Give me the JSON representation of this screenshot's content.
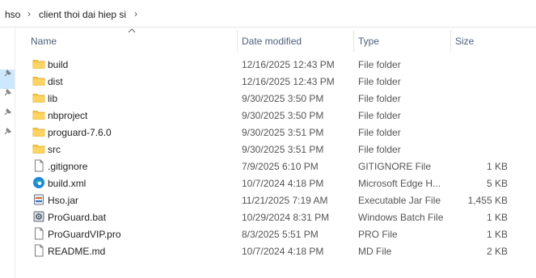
{
  "breadcrumb": {
    "items": [
      "hso",
      "client thoi dai hiep si"
    ],
    "separator": "›"
  },
  "columns": {
    "name": "Name",
    "date": "Date modified",
    "type": "Type",
    "size": "Size"
  },
  "sort_indicator": "chevron-up-icon",
  "files": [
    {
      "name": "build",
      "date": "12/16/2025 12:43 PM",
      "type": "File folder",
      "size": "",
      "icon": "folder-icon"
    },
    {
      "name": "dist",
      "date": "12/16/2025 12:43 PM",
      "type": "File folder",
      "size": "",
      "icon": "folder-icon"
    },
    {
      "name": "lib",
      "date": "9/30/2025 3:50 PM",
      "type": "File folder",
      "size": "",
      "icon": "folder-icon"
    },
    {
      "name": "nbproject",
      "date": "9/30/2025 3:50 PM",
      "type": "File folder",
      "size": "",
      "icon": "folder-icon"
    },
    {
      "name": "proguard-7.6.0",
      "date": "9/30/2025 3:51 PM",
      "type": "File folder",
      "size": "",
      "icon": "folder-icon"
    },
    {
      "name": "src",
      "date": "9/30/2025 3:51 PM",
      "type": "File folder",
      "size": "",
      "icon": "folder-icon"
    },
    {
      "name": ".gitignore",
      "date": "7/9/2025 6:10 PM",
      "type": "GITIGNORE File",
      "size": "1 KB",
      "icon": "file-icon"
    },
    {
      "name": "build.xml",
      "date": "10/7/2024 4:18 PM",
      "type": "Microsoft Edge H...",
      "size": "5 KB",
      "icon": "edge-icon"
    },
    {
      "name": "Hso.jar",
      "date": "11/21/2025 7:19 AM",
      "type": "Executable Jar File",
      "size": "1,455 KB",
      "icon": "jar-file-icon"
    },
    {
      "name": "ProGuard.bat",
      "date": "10/29/2024 8:31 PM",
      "type": "Windows Batch File",
      "size": "1 KB",
      "icon": "batch-file-icon"
    },
    {
      "name": "ProGuardVIP.pro",
      "date": "8/3/2025 5:51 PM",
      "type": "PRO File",
      "size": "1 KB",
      "icon": "file-icon"
    },
    {
      "name": "README.md",
      "date": "10/7/2024 4:18 PM",
      "type": "MD File",
      "size": "2 KB",
      "icon": "file-icon"
    }
  ],
  "colors": {
    "folder": "#f8c846",
    "header_text": "#4c607a",
    "selection": "#cce8ff"
  }
}
